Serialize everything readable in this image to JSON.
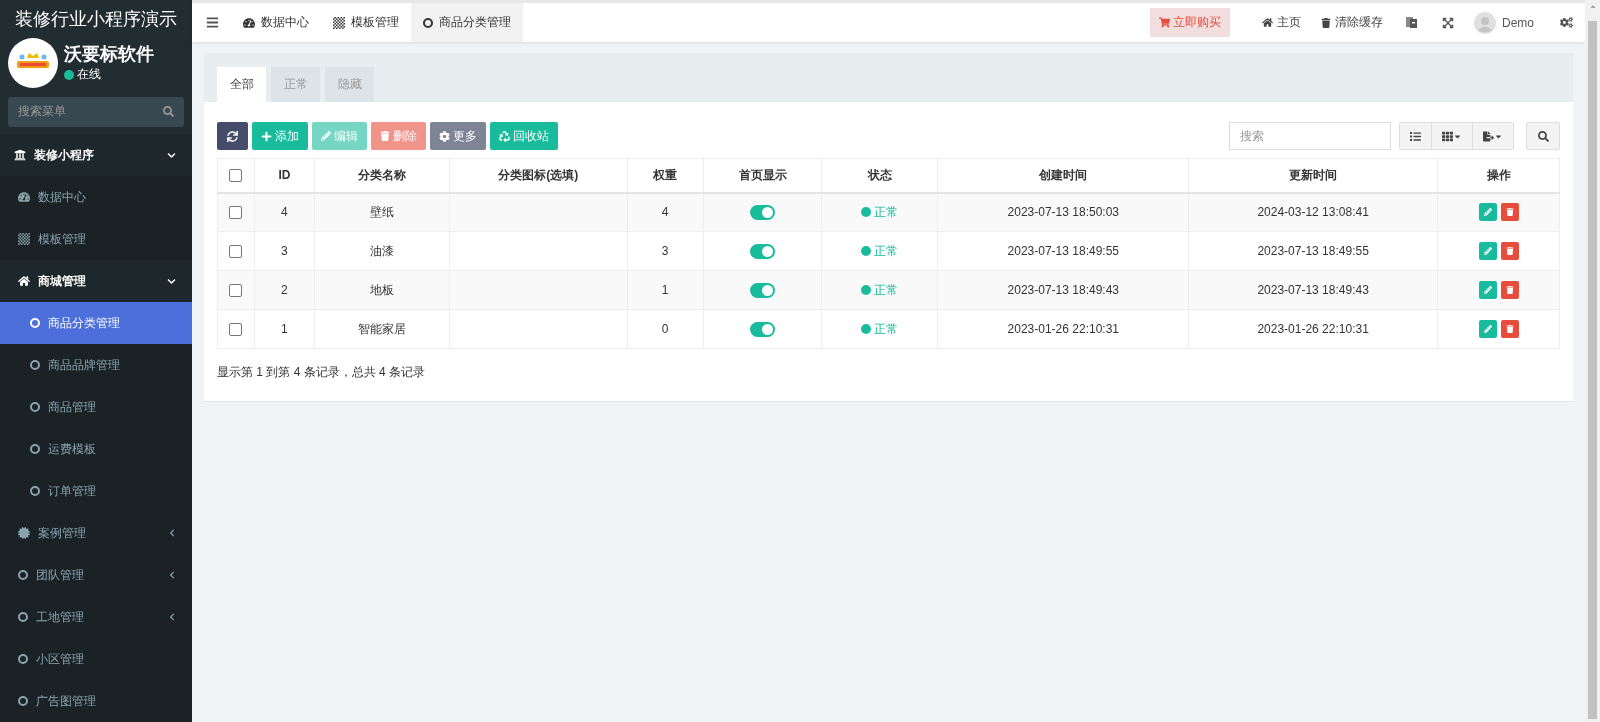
{
  "sidebar": {
    "app_title": "装修行业小程序演示",
    "user": {
      "name": "沃要标软件",
      "status": "在线",
      "online": true
    },
    "search": {
      "placeholder": "搜索菜单"
    },
    "menu": [
      {
        "label": "装修小程序",
        "expanded": true,
        "selected": false,
        "children": [
          {
            "label": "数据中心",
            "selected": false
          },
          {
            "label": "模板管理",
            "selected": false
          },
          {
            "label": "商城管理",
            "expanded": true,
            "selected": false,
            "children": [
              {
                "label": "商品分类管理",
                "selected": true
              },
              {
                "label": "商品品牌管理",
                "selected": false
              },
              {
                "label": "商品管理",
                "selected": false
              },
              {
                "label": "运费模板",
                "selected": false
              },
              {
                "label": "订单管理",
                "selected": false
              }
            ]
          },
          {
            "label": "案例管理",
            "expanded": false,
            "selected": false
          },
          {
            "label": "团队管理",
            "expanded": false,
            "selected": false
          },
          {
            "label": "工地管理",
            "expanded": false,
            "selected": false
          },
          {
            "label": "小区管理",
            "selected": false
          },
          {
            "label": "广告图管理",
            "selected": false
          }
        ]
      }
    ]
  },
  "topbar": {
    "tabs": [
      {
        "label": "数据中心",
        "selected": false
      },
      {
        "label": "模板管理",
        "selected": false
      },
      {
        "label": "商品分类管理",
        "selected": true
      }
    ],
    "buy_button": "立即购买",
    "links": [
      "主页",
      "清除缓存"
    ],
    "user": "Demo"
  },
  "panel": {
    "tabs": [
      {
        "label": "全部",
        "selected": true
      },
      {
        "label": "正常",
        "selected": false
      },
      {
        "label": "隐藏",
        "selected": false
      }
    ],
    "toolbar": [
      {
        "kind": "refresh",
        "disabled": false
      },
      {
        "kind": "add",
        "label": "添加",
        "disabled": false
      },
      {
        "kind": "edit",
        "label": "编辑",
        "disabled": true
      },
      {
        "kind": "delete",
        "label": "删除",
        "disabled": true
      },
      {
        "kind": "more",
        "label": "更多",
        "disabled": false
      },
      {
        "kind": "recycle",
        "label": "回收站",
        "disabled": false
      }
    ],
    "search": {
      "placeholder": "搜索"
    },
    "table": {
      "select_all_checked": false,
      "columns": [
        "ID",
        "分类名称",
        "分类图标(选填)",
        "权重",
        "首页显示",
        "状态",
        "创建时间",
        "更新时间",
        "操作"
      ],
      "rows": [
        {
          "checked": false,
          "id": "4",
          "name": "壁纸",
          "weight": "4",
          "home_display": true,
          "status": "正常",
          "created": "2023-07-13 18:50:03",
          "updated": "2024-03-12 13:08:41"
        },
        {
          "checked": false,
          "id": "3",
          "name": "油漆",
          "weight": "3",
          "home_display": true,
          "status": "正常",
          "created": "2023-07-13 18:49:55",
          "updated": "2023-07-13 18:49:55"
        },
        {
          "checked": false,
          "id": "2",
          "name": "地板",
          "weight": "1",
          "home_display": true,
          "status": "正常",
          "created": "2023-07-13 18:49:43",
          "updated": "2023-07-13 18:49:43"
        },
        {
          "checked": false,
          "id": "1",
          "name": "智能家居",
          "weight": "0",
          "home_display": true,
          "status": "正常",
          "created": "2023-01-26 22:10:31",
          "updated": "2023-01-26 22:10:31"
        }
      ]
    },
    "summary": "显示第 1 到第 4 条记录，总共 4 条记录"
  }
}
